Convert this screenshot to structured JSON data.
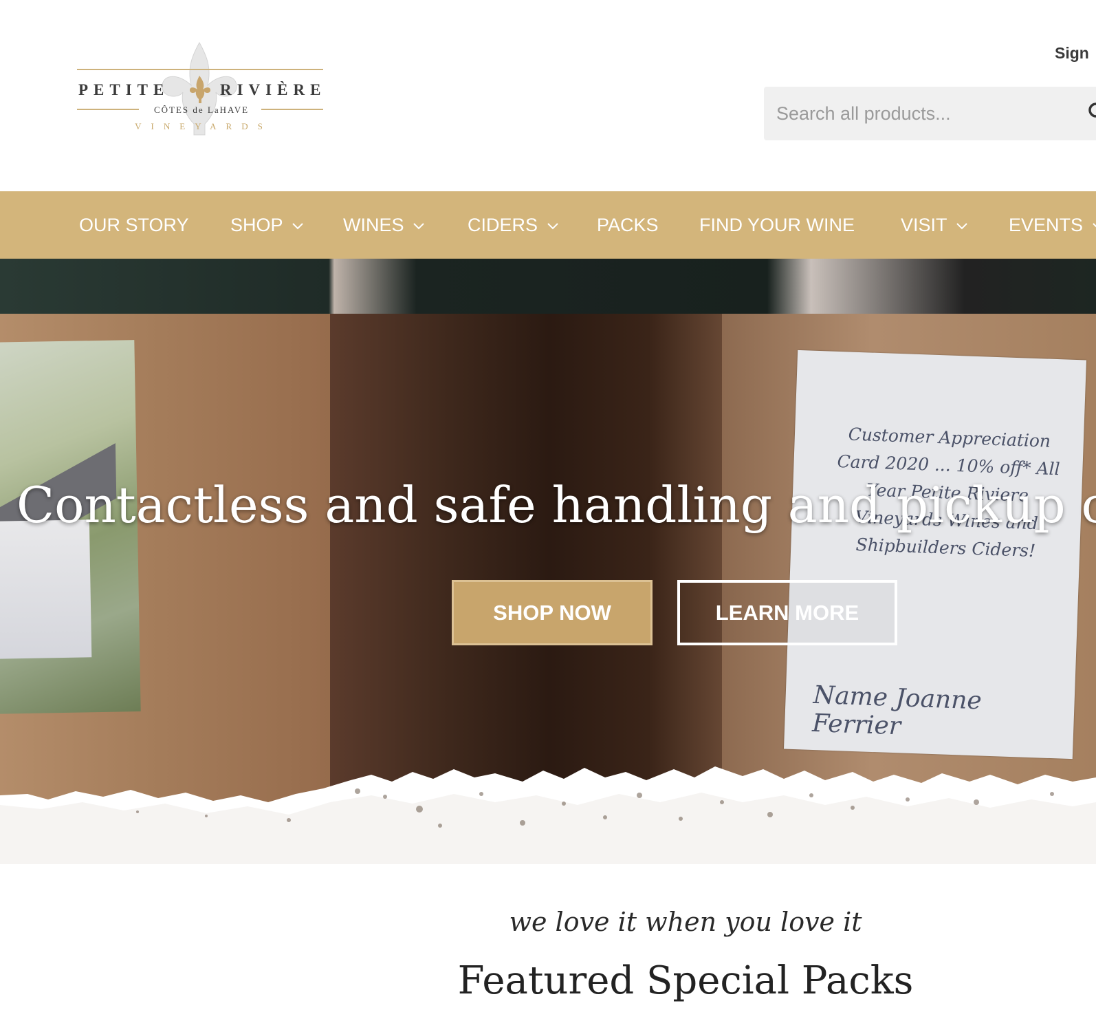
{
  "header": {
    "logo": {
      "line1_left": "PETITE",
      "line1_right": "RIVIÈRE",
      "line2": "CÔTES de LaHAVE",
      "line3": "VINEYARDS"
    },
    "signin_label": "Sign",
    "search": {
      "placeholder": "Search all products..."
    }
  },
  "nav": {
    "items": [
      {
        "label": "OUR STORY",
        "dropdown": false
      },
      {
        "label": "SHOP",
        "dropdown": true
      },
      {
        "label": "WINES",
        "dropdown": true
      },
      {
        "label": "CIDERS",
        "dropdown": true
      },
      {
        "label": "PACKS",
        "dropdown": false
      },
      {
        "label": "FIND YOUR WINE",
        "dropdown": false
      },
      {
        "label": "VISIT",
        "dropdown": true
      },
      {
        "label": "EVENTS",
        "dropdown": true
      }
    ]
  },
  "hero": {
    "headline": "Contactless and safe handling and pickup or",
    "shop_now": "SHOP NOW",
    "learn_more": "LEARN MORE",
    "card_text": "Customer Appreciation Card 2020 ... 10% off* All Year Petite Riviere Vineyards Wines and Shipbuilders Ciders!",
    "card_name": "Name Joanne Ferrier"
  },
  "featured": {
    "tagline": "we love it when you love it",
    "title": "Featured Special Packs"
  },
  "colors": {
    "brand_gold": "#d3b57b",
    "button_gold": "#c8a56c",
    "text_dark": "#222222"
  }
}
